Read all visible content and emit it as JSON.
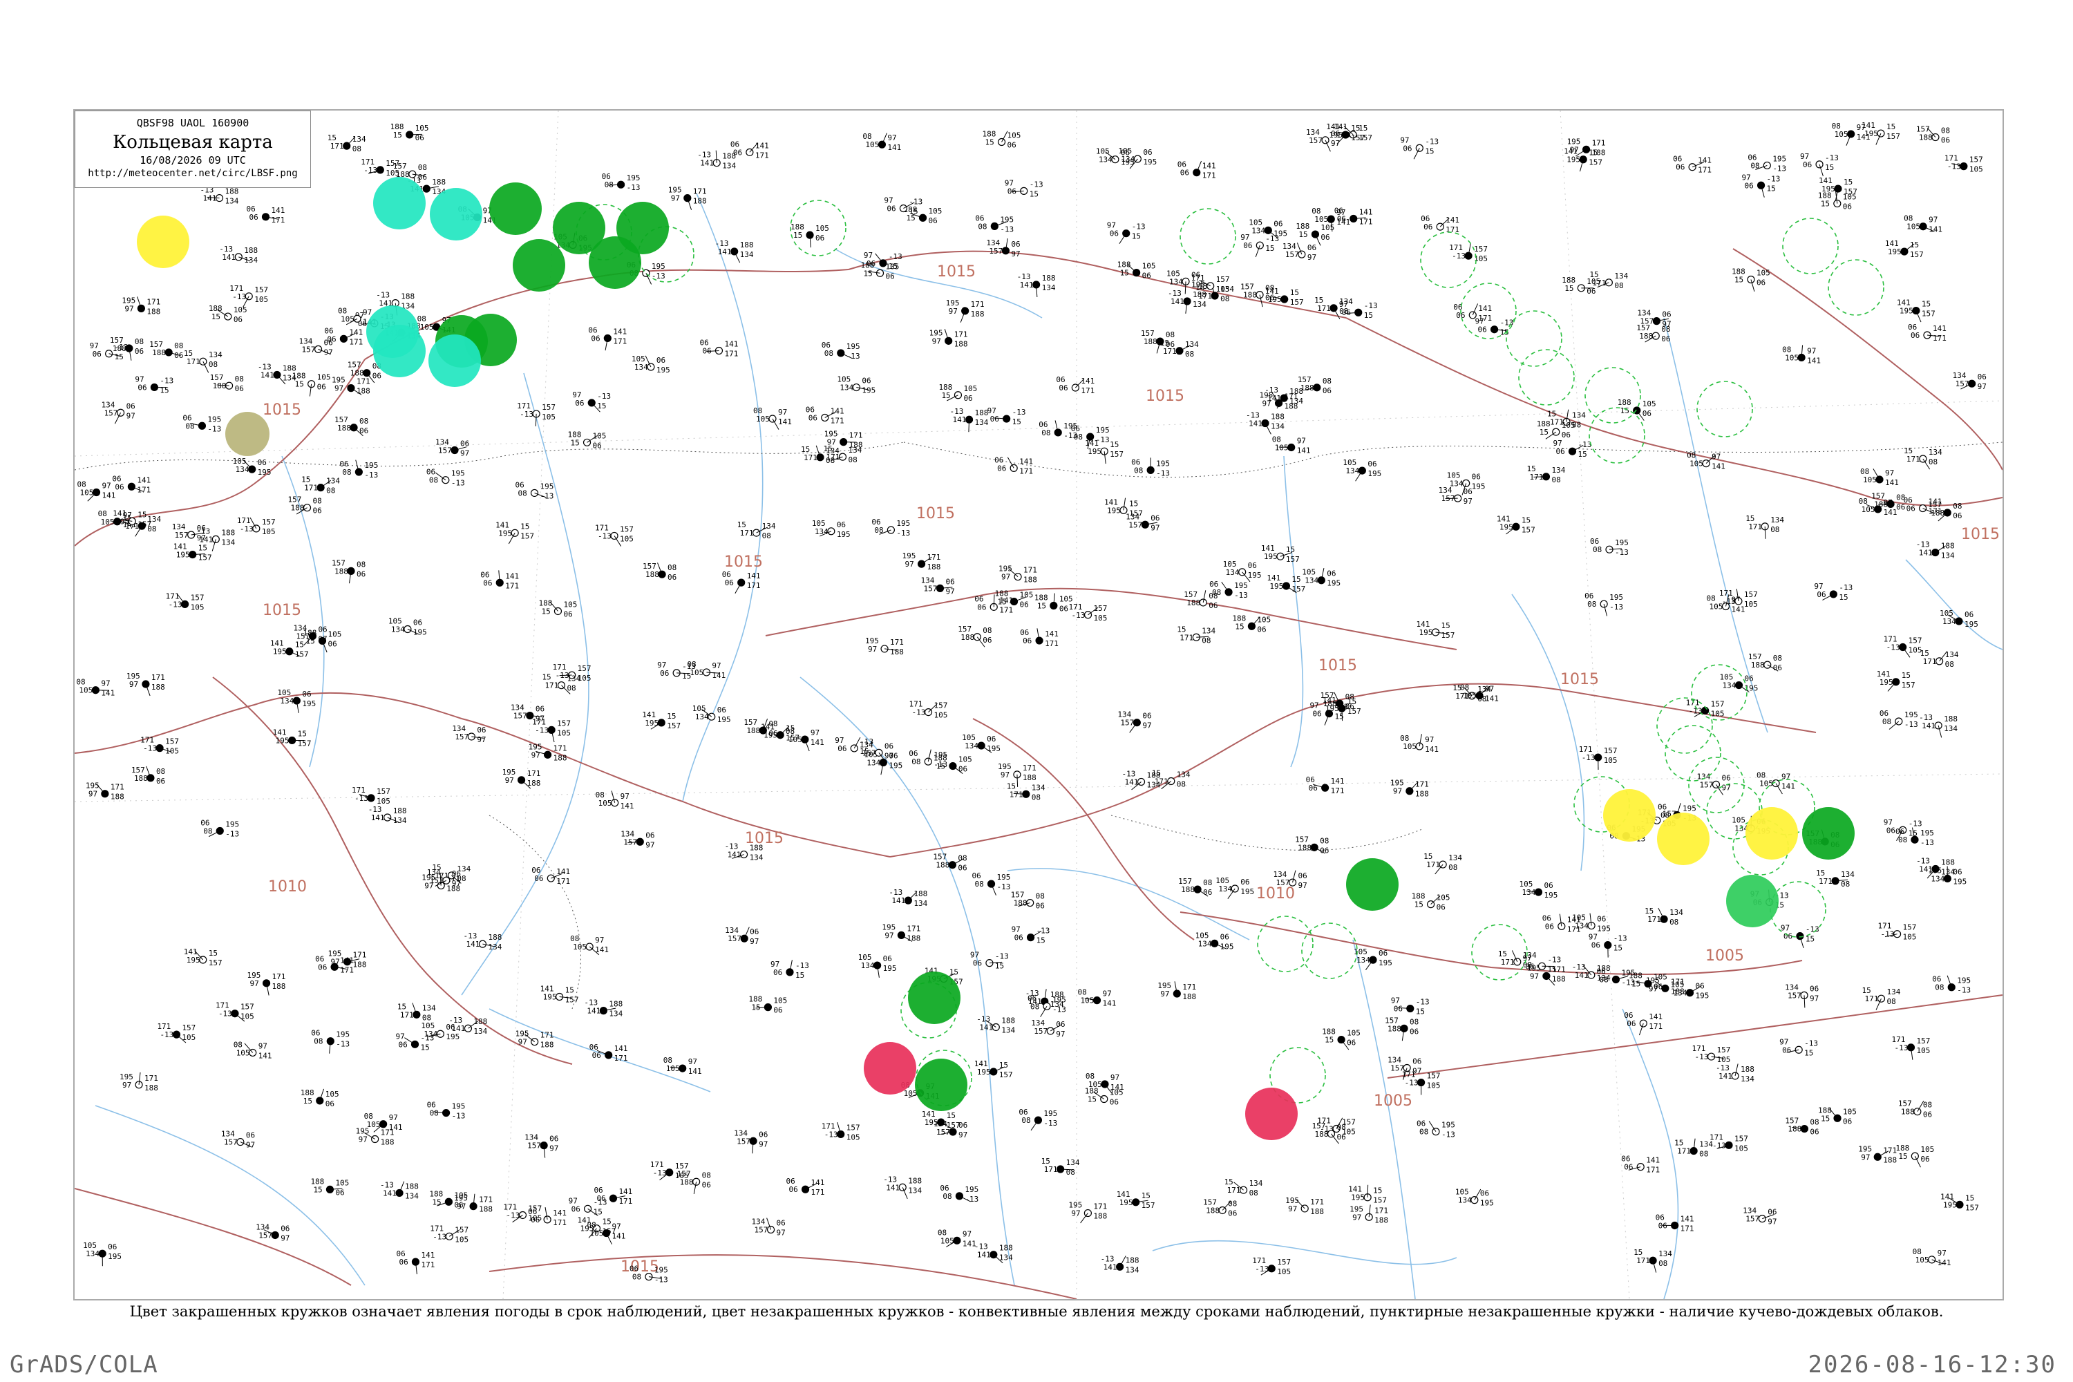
{
  "legend": {
    "code": "QBSF98  UAOL  160900",
    "title": "Кольцевая карта",
    "time": "16/08/2026 09 UTC",
    "url": "http://meteocenter.net/circ/LBSF.png"
  },
  "caption": "Цвет закрашенных кружков означает явления погоды в срок наблюдений, цвет незакрашенных кружков - конвективные явления между сроками наблюдений, пунктирные незакрашенные кружки - наличие кучево-дождевых облаков.",
  "footer": {
    "left": "GrADS/COLA",
    "right": "2026-08-16-12:30"
  },
  "isobar_label": "1015",
  "isobar_labels": [
    "1015",
    "1015",
    "1015",
    "1015",
    "1015",
    "1015",
    "1015",
    "1015",
    "1015",
    "1015",
    "1010",
    "1010",
    "1005",
    "1005",
    "1015"
  ],
  "colors": {
    "green": "#0aa81f",
    "green_light": "#2ecc5a",
    "cyan": "#22e6c0",
    "yellow": "#fff23a",
    "red": "#e8305a",
    "olive": "#b8b47a",
    "isobar": "#b06060",
    "river": "#8cc0e8",
    "dashed_ring": "#2bbf40"
  },
  "filled_circles": [
    {
      "color": "green"
    },
    {
      "color": "green"
    },
    {
      "color": "green"
    },
    {
      "color": "green"
    },
    {
      "color": "green"
    },
    {
      "color": "green"
    },
    {
      "color": "green"
    },
    {
      "color": "green"
    },
    {
      "color": "green"
    },
    {
      "color": "green"
    },
    {
      "color": "cyan"
    },
    {
      "color": "cyan"
    },
    {
      "color": "cyan"
    },
    {
      "color": "cyan"
    },
    {
      "color": "cyan"
    },
    {
      "color": "yellow"
    },
    {
      "color": "yellow"
    },
    {
      "color": "yellow"
    },
    {
      "color": "yellow"
    },
    {
      "color": "red"
    },
    {
      "color": "red"
    },
    {
      "color": "olive"
    },
    {
      "color": "green_light"
    },
    {
      "color": "green"
    }
  ],
  "station_samples": [
    "195",
    "171",
    "157",
    "08",
    "97",
    "-13",
    "188",
    "105",
    "06",
    "141",
    "15",
    "134",
    "06"
  ]
}
